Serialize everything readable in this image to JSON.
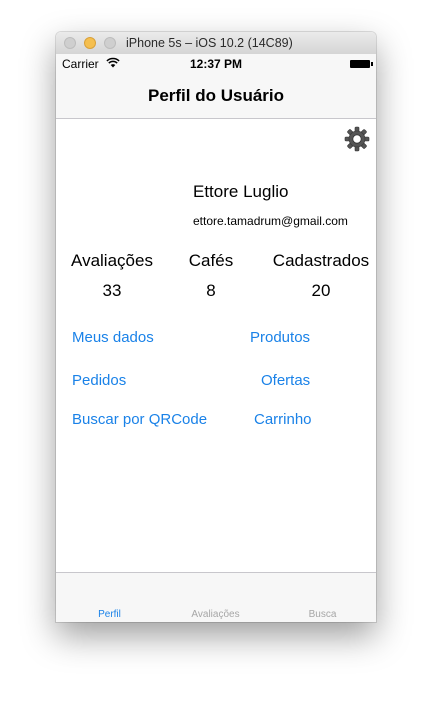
{
  "window": {
    "title": "iPhone 5s – iOS 10.2 (14C89)"
  },
  "status": {
    "carrier": "Carrier",
    "time": "12:37 PM"
  },
  "nav": {
    "title": "Perfil do Usuário"
  },
  "profile": {
    "name": "Ettore Luglio",
    "email": "ettore.tamadrum@gmail.com"
  },
  "stats": [
    {
      "label": "Avaliações",
      "value": "33"
    },
    {
      "label": "Cafés",
      "value": "8"
    },
    {
      "label": "Cadastrados",
      "value": "20"
    }
  ],
  "links": {
    "meus_dados": "Meus dados",
    "produtos": "Produtos",
    "pedidos": "Pedidos",
    "ofertas": "Ofertas",
    "buscar_qrcode": "Buscar por QRCode",
    "carrinho": "Carrinho"
  },
  "tabs": [
    {
      "label": "Perfil",
      "active": true
    },
    {
      "label": "Avaliações",
      "active": false
    },
    {
      "label": "Busca",
      "active": false
    }
  ],
  "colors": {
    "accent": "#1a82e8",
    "inactive_tab": "#a6a6a6"
  },
  "icons": {
    "settings": "gear-icon",
    "wifi": "wifi-icon",
    "battery": "battery-icon"
  }
}
